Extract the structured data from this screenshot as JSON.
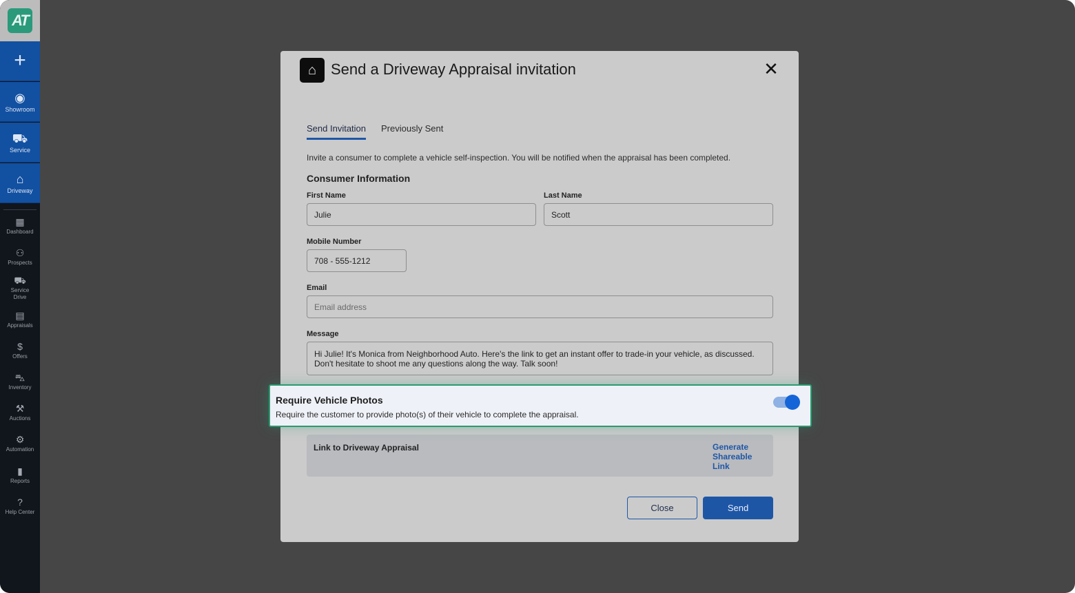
{
  "app": {
    "logo_text": "AT",
    "accent_color": "#1e56a6",
    "brand_color": "#2a9a7b"
  },
  "sidebar": {
    "top_actions": [
      {
        "label": "",
        "icon": "plus-icon"
      },
      {
        "label": "Showroom",
        "icon": "person-circle-icon"
      },
      {
        "label": "Service",
        "icon": "car-service-icon"
      },
      {
        "label": "Driveway",
        "icon": "garage-icon"
      }
    ],
    "items": [
      {
        "label": "Dashboard",
        "icon": "dashboard-icon"
      },
      {
        "label": "Prospects",
        "icon": "people-icon"
      },
      {
        "label": "Service Drive",
        "icon": "car-front-icon"
      },
      {
        "label": "Appraisals",
        "icon": "clipboard-icon"
      },
      {
        "label": "Offers",
        "icon": "dollar-icon"
      },
      {
        "label": "Inventory",
        "icon": "car-icon"
      },
      {
        "label": "Auctions",
        "icon": "gavel-icon"
      },
      {
        "label": "Automation",
        "icon": "robot-icon"
      },
      {
        "label": "Reports",
        "icon": "bar-chart-icon"
      },
      {
        "label": "Help Center",
        "icon": "help-icon"
      }
    ]
  },
  "modal": {
    "title": "Send a Driveway Appraisal invitation",
    "close_glyph": "✕",
    "tabs": [
      {
        "label": "Send Invitation",
        "active": true
      },
      {
        "label": "Previously Sent",
        "active": false
      }
    ],
    "intro": "Invite a consumer to complete a vehicle self-inspection. You will be notified when the appraisal has been completed.",
    "section_title": "Consumer Information",
    "first_name": {
      "label": "First Name",
      "value": "Julie"
    },
    "last_name": {
      "label": "Last Name",
      "value": "Scott"
    },
    "mobile": {
      "label": "Mobile Number",
      "value": "708 - 555-1212"
    },
    "email": {
      "label": "Email",
      "value": "",
      "placeholder": "Email address"
    },
    "message": {
      "label": "Message",
      "value": "Hi Julie! It's Monica from Neighborhood Auto. Here's the link to get an instant offer to trade-in your vehicle, as discussed. Don't hesitate to shoot me any questions along the way. Talk soon!"
    },
    "require_photos": {
      "title": "Require Vehicle Photos",
      "description": "Require the customer to provide photo(s) of their vehicle to complete the appraisal.",
      "enabled": true
    },
    "link_section": {
      "label": "Link to Driveway Appraisal",
      "action": "Generate Shareable Link"
    },
    "buttons": {
      "close": "Close",
      "send": "Send"
    }
  }
}
